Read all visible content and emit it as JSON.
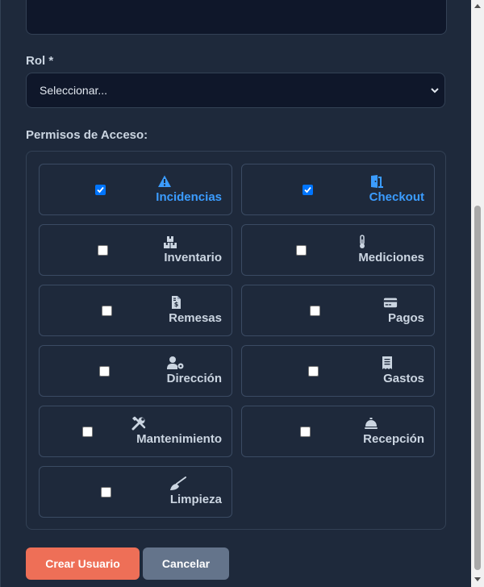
{
  "form": {
    "rol_label": "Rol *",
    "rol_select_value": "Seleccionar...",
    "permisos_label": "Permisos de Acceso:"
  },
  "permissions": [
    {
      "label": "Incidencias",
      "checked": true,
      "icon": "warning-icon"
    },
    {
      "label": "Checkout",
      "checked": true,
      "icon": "door-exit-icon"
    },
    {
      "label": "Inventario",
      "checked": false,
      "icon": "boxes-icon"
    },
    {
      "label": "Mediciones",
      "checked": false,
      "icon": "thermometer-icon"
    },
    {
      "label": "Remesas",
      "checked": false,
      "icon": "invoice-dollar-icon"
    },
    {
      "label": "Pagos",
      "checked": false,
      "icon": "credit-card-icon"
    },
    {
      "label": "Dirección",
      "checked": false,
      "icon": "user-gear-icon"
    },
    {
      "label": "Gastos",
      "checked": false,
      "icon": "receipt-icon"
    },
    {
      "label": "Mantenimiento",
      "checked": false,
      "icon": "tools-icon"
    },
    {
      "label": "Recepción",
      "checked": false,
      "icon": "concierge-bell-icon"
    },
    {
      "label": "Limpieza",
      "checked": false,
      "icon": "broom-icon"
    }
  ],
  "buttons": {
    "create_label": "Crear Usuario",
    "cancel_label": "Cancelar"
  },
  "colors": {
    "background": "#1e293b",
    "input_bg": "#0f172a",
    "active_text": "#3b9cff",
    "create_button": "#ee6f57",
    "cancel_button": "#64748b"
  }
}
